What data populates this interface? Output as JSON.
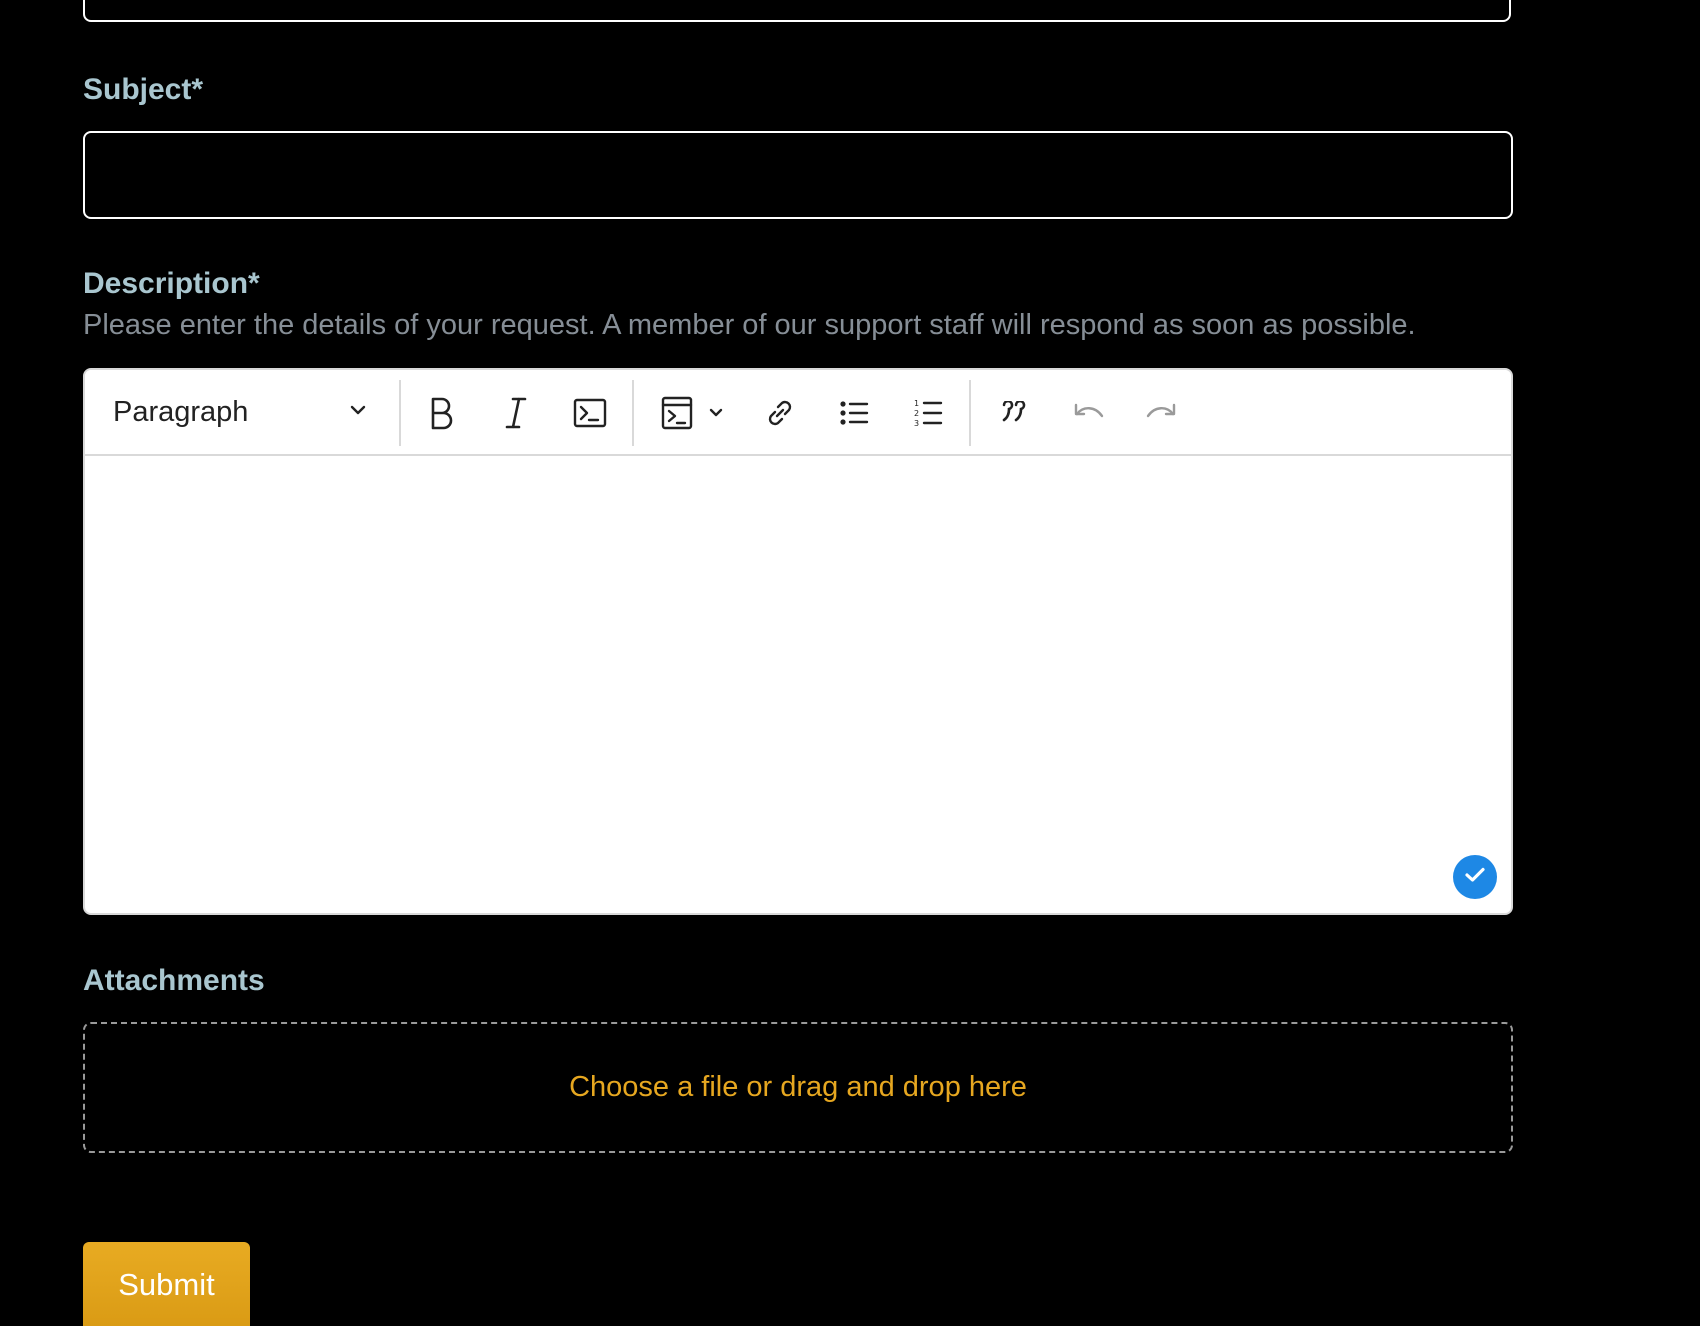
{
  "form": {
    "subject": {
      "label": "Subject*",
      "value": "",
      "placeholder": ""
    },
    "description": {
      "label": "Description*",
      "hint": "Please enter the details of your request. A member of our support staff will respond as soon as possible.",
      "editor": {
        "heading_select": "Paragraph",
        "toolbar_icons": [
          "bold-icon",
          "italic-icon",
          "code-icon",
          "code-block-icon",
          "chevron-down-icon",
          "link-icon",
          "bulleted-list-icon",
          "numbered-list-icon",
          "blockquote-icon",
          "undo-icon",
          "redo-icon"
        ],
        "content": "",
        "status_icon": "check-icon"
      }
    },
    "attachments": {
      "label": "Attachments",
      "dropzone_text": "Choose a file or drag and drop here"
    },
    "submit_label": "Submit"
  },
  "colors": {
    "background": "#000000",
    "label": "#a9c6cf",
    "hint": "#868e96",
    "accent": "#e6a720",
    "status_badge": "#1e88e5"
  }
}
